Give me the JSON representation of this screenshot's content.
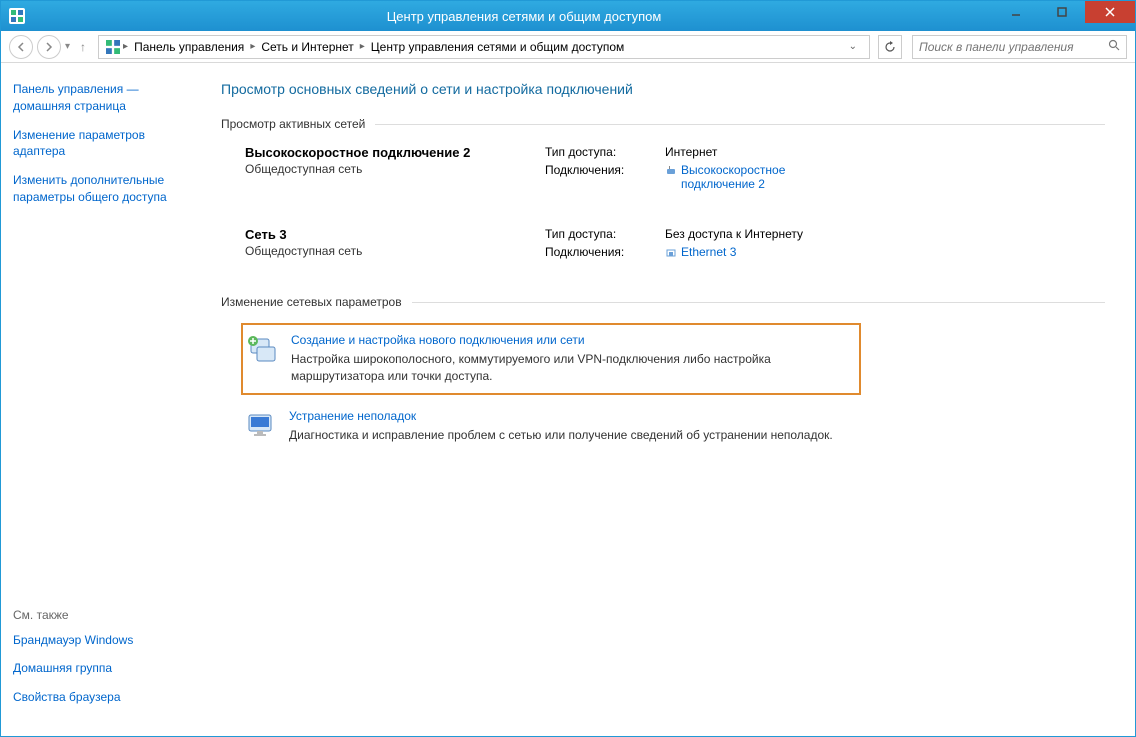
{
  "window": {
    "title": "Центр управления сетями и общим доступом"
  },
  "breadcrumb": {
    "items": [
      "Панель управления",
      "Сеть и Интернет",
      "Центр управления сетями и общим доступом"
    ]
  },
  "search": {
    "placeholder": "Поиск в панели управления"
  },
  "sidebar": {
    "links": [
      "Панель управления — домашняя страница",
      "Изменение параметров адаптера",
      "Изменить дополнительные параметры общего доступа"
    ],
    "see_also_heading": "См. также",
    "see_also": [
      "Брандмауэр Windows",
      "Домашняя группа",
      "Свойства браузера"
    ]
  },
  "main": {
    "heading": "Просмотр основных сведений о сети и настройка подключений",
    "active_networks_heading": "Просмотр активных сетей",
    "networks": [
      {
        "name": "Высокоскоростное подключение 2",
        "type": "Общедоступная сеть",
        "access_label": "Тип доступа:",
        "access_value": "Интернет",
        "conn_label": "Подключения:",
        "conn_value": "Высокоскоростное подключение 2"
      },
      {
        "name": "Сеть  3",
        "type": "Общедоступная сеть",
        "access_label": "Тип доступа:",
        "access_value": "Без доступа к Интернету",
        "conn_label": "Подключения:",
        "conn_value": "Ethernet 3"
      }
    ],
    "change_settings_heading": "Изменение сетевых параметров",
    "settings": [
      {
        "title": "Создание и настройка нового подключения или сети",
        "desc": "Настройка широкополосного, коммутируемого или VPN-подключения либо настройка маршрутизатора или точки доступа."
      },
      {
        "title": "Устранение неполадок",
        "desc": "Диагностика и исправление проблем с сетью или получение сведений об устранении неполадок."
      }
    ]
  }
}
